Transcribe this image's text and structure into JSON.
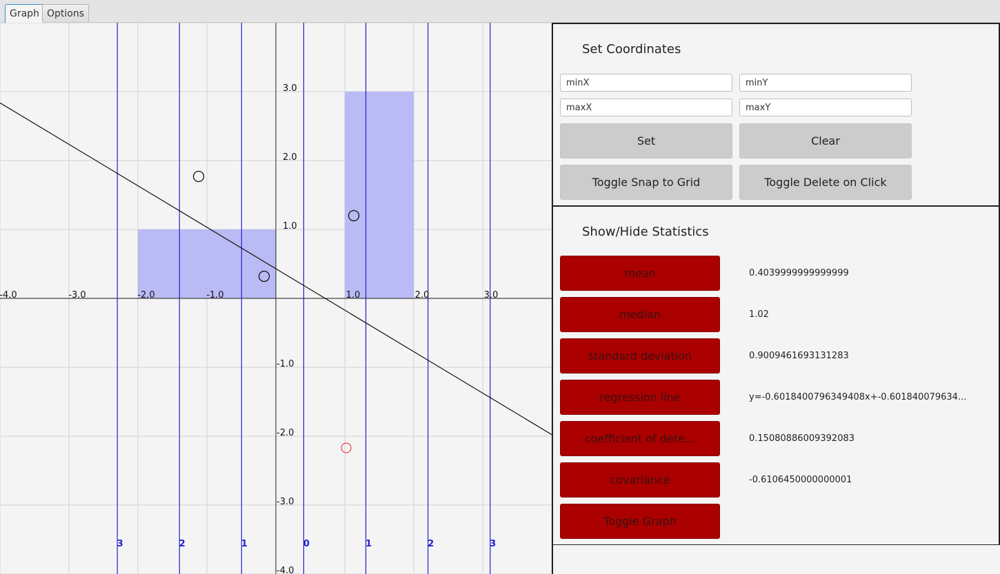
{
  "tabs": [
    "Graph",
    "Options"
  ],
  "graph": {
    "x_ticks": [
      "-4.0",
      "-3.0",
      "-2.0",
      "-1.0",
      "1.0",
      "2.0",
      "3.0"
    ],
    "y_ticks_pos": [
      "3.0",
      "2.0",
      "1.0"
    ],
    "y_ticks_neg": [
      "-1.0",
      "-2.0",
      "-3.0",
      "-4.0"
    ],
    "band_labels": [
      "3",
      "2",
      "1",
      "0",
      "1",
      "2",
      "3"
    ],
    "band_color": "#2020cc",
    "bar_color": "#b6b6f4",
    "outlier_color": "#dd2222",
    "histogram_bars": [
      {
        "x0": -2.0,
        "x1": 0.0,
        "height": 1.0
      },
      {
        "x0": 1.0,
        "x1": 2.0,
        "height": 3.0
      }
    ],
    "points": [
      {
        "x": -1.12,
        "y": 1.77
      },
      {
        "x": -0.17,
        "y": 0.32
      },
      {
        "x": 1.13,
        "y": 1.2
      },
      {
        "x": 1.02,
        "y": -2.17
      }
    ],
    "regression": {
      "slope": -0.6018400796349408,
      "intercept": 0.43
    }
  },
  "coordinates": {
    "title": "Set Coordinates",
    "minx_placeholder": "minX",
    "miny_placeholder": "minY",
    "maxx_placeholder": "maxX",
    "maxy_placeholder": "maxY",
    "set_label": "Set",
    "clear_label": "Clear",
    "snap_label": "Toggle Snap to Grid",
    "delete_label": "Toggle Delete on Click"
  },
  "statistics": {
    "title": "Show/Hide Statistics",
    "rows": [
      {
        "label": "mean",
        "value": "0.4039999999999999"
      },
      {
        "label": "median",
        "value": "1.02"
      },
      {
        "label": "standard deviation",
        "value": "0.9009461693131283"
      },
      {
        "label": "regression line",
        "value": "y=-0.6018400796349408x+-0.601840079634..."
      },
      {
        "label": "coefficient of dete...",
        "value": "0.15080886009392083"
      },
      {
        "label": "covariance",
        "value": "-0.6106450000000001"
      }
    ],
    "toggle_graph_label": "Toggle Graph"
  }
}
